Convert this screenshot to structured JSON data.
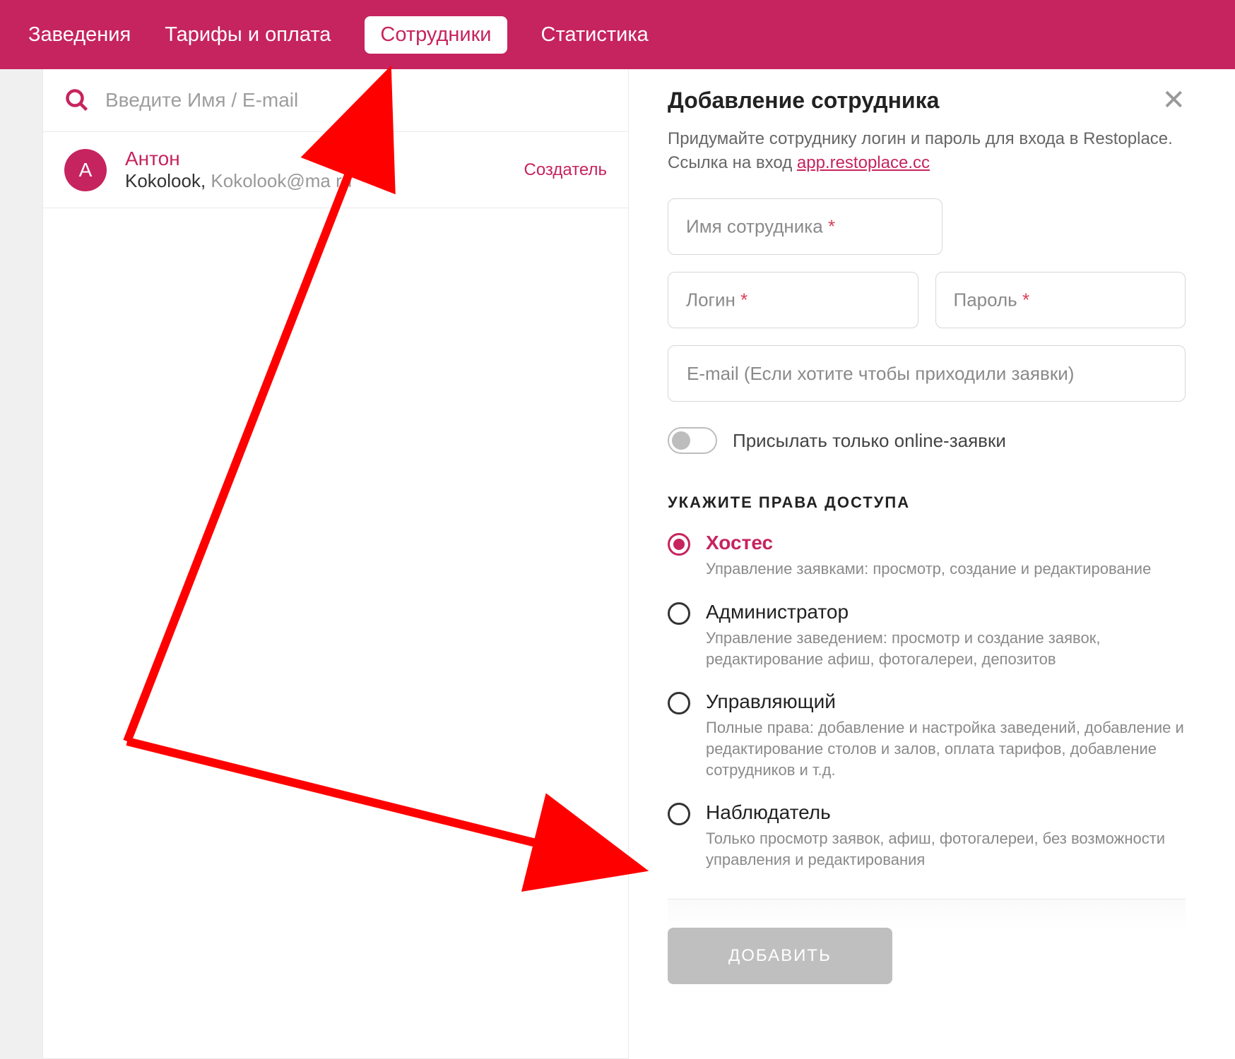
{
  "nav": {
    "items": [
      "Заведения",
      "Тарифы и оплата",
      "Сотрудники",
      "Статистика"
    ],
    "active_index": 2
  },
  "search": {
    "placeholder": "Введите Имя / E-mail"
  },
  "user": {
    "initial": "А",
    "name": "Антон",
    "company": "Kokolook,",
    "email": "Kokolook@ma   ru",
    "badge": "Создатель"
  },
  "panel": {
    "title": "Добавление сотрудника",
    "desc_prefix": "Придумайте сотруднику логин и пароль для входа в Restoplace. Ссылка на вход ",
    "desc_link": "app.restoplace.cc"
  },
  "form": {
    "name_label": "Имя сотрудника ",
    "login_label": "Логин ",
    "password_label": "Пароль ",
    "email_placeholder": "E-mail (Если хотите чтобы приходили заявки)",
    "req": "*",
    "toggle_label": "Присылать только online-заявки"
  },
  "roles_section": "УКАЖИТЕ ПРАВА ДОСТУПА",
  "roles": [
    {
      "title": "Хостес",
      "desc": "Управление заявками: просмотр, создание и редактирование",
      "selected": true
    },
    {
      "title": "Администратор",
      "desc": "Управление заведением: просмотр и создание заявок, редактирование афиш, фотогалереи, депозитов",
      "selected": false
    },
    {
      "title": "Управляющий",
      "desc": "Полные права: добавление и настройка заведений, добавление и редактирование столов и залов, оплата тарифов, добавление сотрудников и т.д.",
      "selected": false
    },
    {
      "title": "Наблюдатель",
      "desc": "Только просмотр заявок, афиш, фотогалереи, без возможности управления и редактирования",
      "selected": false
    }
  ],
  "add_button": "ДОБАВИТЬ"
}
